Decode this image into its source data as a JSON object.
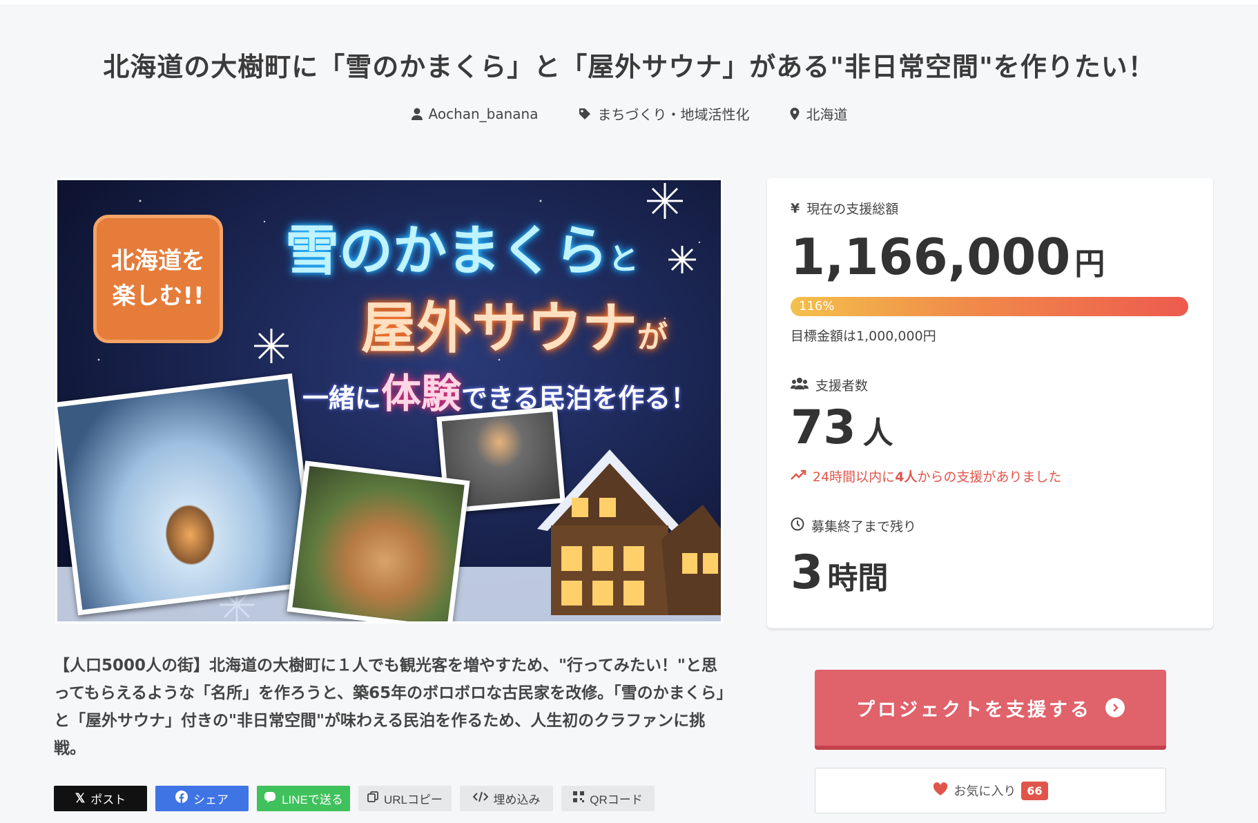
{
  "project": {
    "title": "北海道の大樹町に「雪のかまくら」と「屋外サウナ」がある\"非日常空間\"を作りたい！",
    "author": "Aochan_banana",
    "category": "まちづくり・地域活性化",
    "location": "北海道",
    "description": "【人口5000人の街】北海道の大樹町に１人でも観光客を増やすため、\"行ってみたい！\"と思ってもらえるような「名所」を作ろうと、築65年のボロボロな古民家を改修。「雪のかまくら」と「屋外サウナ」付きの\"非日常空間\"が味わえる民泊を作るため、人生初のクラファンに挑戦。"
  },
  "hero": {
    "badge_line1": "北海道を",
    "badge_line2": "楽しむ!!",
    "line1": "雪のかまくら",
    "line1_suffix": "と",
    "line2": "屋外サウナ",
    "line2_suffix": "が",
    "line3_pre": "一緒に",
    "line3_big": "体験",
    "line3_post": "できる民泊を作る！"
  },
  "stats": {
    "total_label": "現在の支援総額",
    "total_amount": "1,166,000",
    "currency_unit": "円",
    "progress_label": "116%",
    "progress_ratio": 1.16,
    "goal_text": "目標金額は1,000,000円",
    "supporters_label": "支援者数",
    "supporters_count": "73",
    "supporters_unit": "人",
    "recent_pre": "24時間以内に",
    "recent_num": "4人",
    "recent_post": "からの支援がありました",
    "remaining_label": "募集終了まで残り",
    "remaining_value": "3",
    "remaining_unit": "時間"
  },
  "actions": {
    "support_label": "プロジェクトを支援する",
    "favorite_label": "お気に入り",
    "favorite_count": "66"
  },
  "share": {
    "x_label": "ポスト",
    "facebook_label": "シェア",
    "line_label": "LINEで送る",
    "url_label": "URLコピー",
    "embed_label": "埋め込み",
    "qr_label": "QRコード"
  },
  "colors": {
    "accent": "#e0626a",
    "highlight": "#e0554b",
    "progress_start": "#f4c04b",
    "progress_end": "#ee5a4e"
  }
}
